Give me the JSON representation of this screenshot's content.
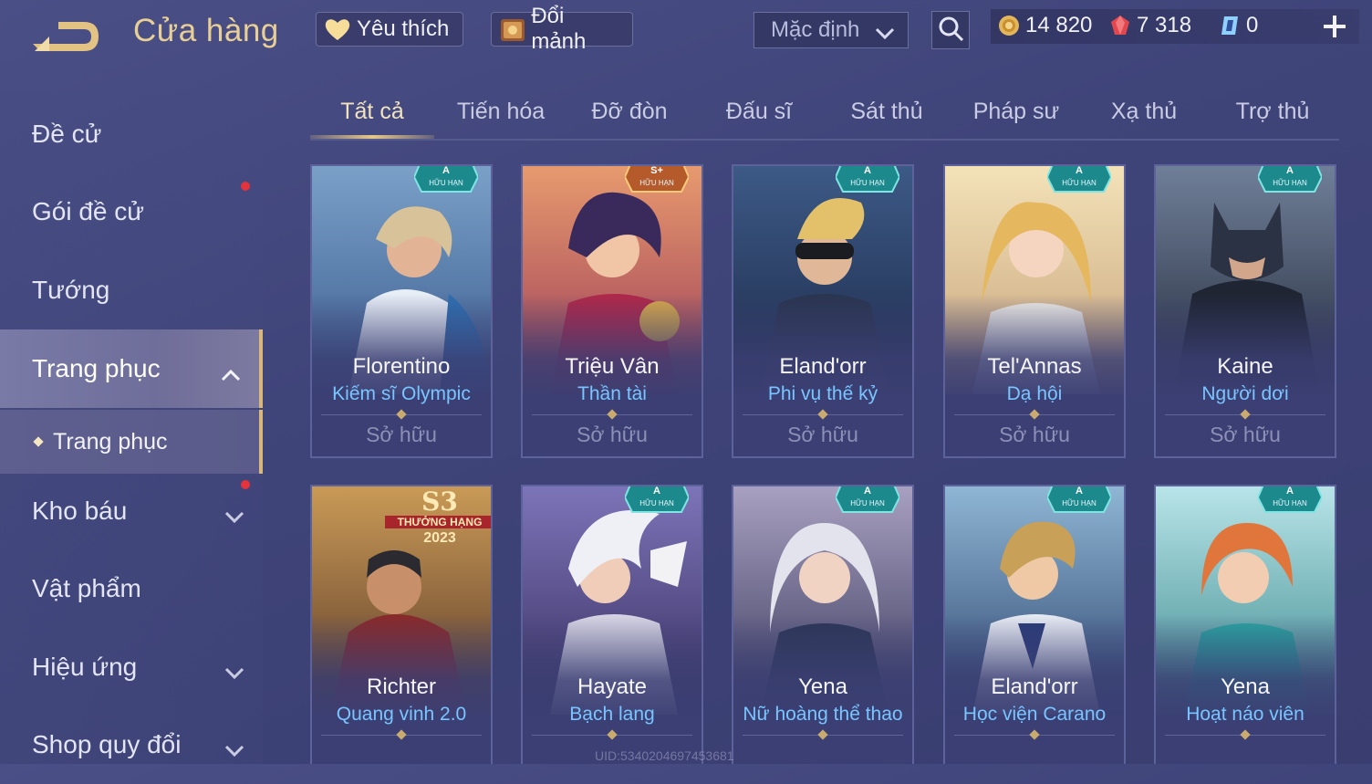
{
  "header": {
    "title": "Cửa hàng",
    "favorite_label": "Yêu thích",
    "swap_label": "Đổi mảnh",
    "sort_value": "Mặc định",
    "currencies": {
      "coin": "14 820",
      "gem": "7 318",
      "voucher": "0"
    },
    "icons": {
      "back": "back-arrow-icon",
      "favorite": "heart-icon",
      "swap": "fragment-chest-icon",
      "search": "search-icon",
      "add": "plus-icon"
    }
  },
  "sidebar": {
    "items": [
      {
        "label": "Đề cử"
      },
      {
        "label": "Gói đề cử"
      },
      {
        "label": "Tướng"
      },
      {
        "label": "Trang phục"
      },
      {
        "label": "Trang phục"
      },
      {
        "label": "Kho báu"
      },
      {
        "label": "Vật phẩm"
      },
      {
        "label": "Hiệu ứng"
      },
      {
        "label": "Shop quy đổi"
      }
    ]
  },
  "tabs": [
    "Tất cả",
    "Tiến hóa",
    "Đỡ đòn",
    "Đấu sĩ",
    "Sát thủ",
    "Pháp sư",
    "Xạ thủ",
    "Trợ thủ"
  ],
  "cards": [
    {
      "hero": "Florentino",
      "skin": "Kiếm sĩ Olympic",
      "status": "Sở hữu",
      "badge": "A",
      "badge_sub": "HỮU HẠN"
    },
    {
      "hero": "Triệu Vân",
      "skin": "Thần tài",
      "status": "Sở hữu",
      "badge": "S+",
      "badge_sub": "HỮU HẠN"
    },
    {
      "hero": "Eland'orr",
      "skin": "Phi vụ thế kỷ",
      "status": "Sở hữu",
      "badge": "A",
      "badge_sub": "HỮU HẠN"
    },
    {
      "hero": "Tel'Annas",
      "skin": "Dạ hội",
      "status": "Sở hữu",
      "badge": "A",
      "badge_sub": "HỮU HẠN"
    },
    {
      "hero": "Kaine",
      "skin": "Người dơi",
      "status": "Sở hữu",
      "badge": "A",
      "badge_sub": "HỮU HẠN"
    },
    {
      "hero": "Richter",
      "skin": "Quang vinh 2.0",
      "season": "S3",
      "season_rank": "THƯỞNG HẠNG",
      "season_year": "2023"
    },
    {
      "hero": "Hayate",
      "skin": "Bạch lang",
      "badge": "A",
      "badge_sub": "HỮU HẠN"
    },
    {
      "hero": "Yena",
      "skin": "Nữ hoàng thể thao",
      "badge": "A",
      "badge_sub": "HỮU HẠN"
    },
    {
      "hero": "Eland'orr",
      "skin": "Học viện Carano",
      "badge": "A",
      "badge_sub": "HỮU HẠN"
    },
    {
      "hero": "Yena",
      "skin": "Hoạt náo viên",
      "badge": "A",
      "badge_sub": "HỮU HẠN"
    }
  ],
  "uid": "UID:5340204697453681",
  "colors": {
    "accent_gold": "#e8cf96",
    "skin_name_blue": "#79c5ff",
    "notification_red": "#e5333b"
  }
}
